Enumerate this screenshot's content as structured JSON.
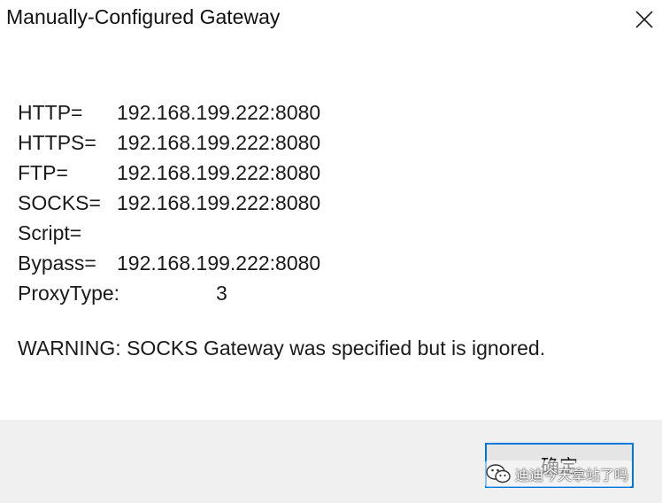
{
  "dialog": {
    "title": "Manually-Configured Gateway",
    "rows": [
      {
        "key": "HTTP=",
        "value": "192.168.199.222:8080"
      },
      {
        "key": "HTTPS=",
        "value": "192.168.199.222:8080"
      },
      {
        "key": "FTP=",
        "value": "192.168.199.222:8080"
      },
      {
        "key": "SOCKS=",
        "value": "192.168.199.222:8080"
      },
      {
        "key": "Script=",
        "value": ""
      },
      {
        "key": "Bypass=",
        "value": "192.168.199.222:8080"
      },
      {
        "key": "ProxyType:",
        "value": "3"
      }
    ],
    "warning": "WARNING: SOCKS Gateway was specified but is ignored.",
    "ok_label": "确定",
    "close_icon": "close-icon"
  },
  "watermark": {
    "text": "迪迪今天拿站了吗",
    "icon": "wechat-icon"
  },
  "colors": {
    "accent": "#0078d7",
    "footer_bg": "#f0f0f0",
    "button_bg": "#e5e5e5"
  }
}
